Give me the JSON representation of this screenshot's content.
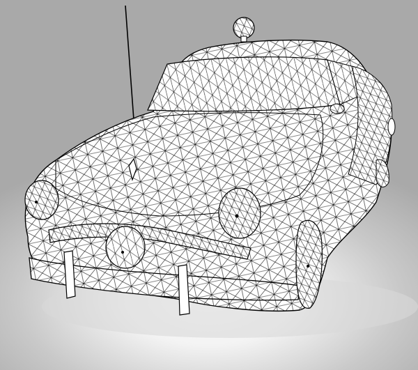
{
  "scene": {
    "subject": "wireframe-car-model",
    "colors": {
      "background_light": "#f2f2f2",
      "background_dark": "#a8a8a8",
      "body_fill": "#ffffff",
      "wire_line": "#111111"
    },
    "parts": [
      "antenna",
      "roof-light",
      "windshield",
      "hood",
      "hood-ornament",
      "left-headlight",
      "right-headlight",
      "grille",
      "front-bumper",
      "bumper-guards",
      "front-wheel-right",
      "side-mirror"
    ]
  }
}
